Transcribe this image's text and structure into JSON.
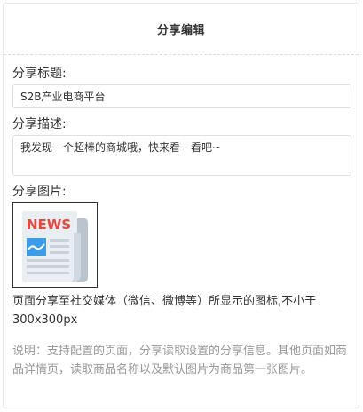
{
  "header": {
    "title": "分享编辑"
  },
  "form": {
    "title_label": "分享标题:",
    "title_value": "S2B产业电商平台",
    "desc_label": "分享描述:",
    "desc_value": "我发现一个超棒的商城哦，快来看一看吧~",
    "image_label": "分享图片:",
    "image": {
      "icon": "news-icon",
      "badge_text": "NEWS"
    },
    "image_hint": "页面分享至社交媒体（微信、微博等）所显示的图标,不小于300x300px",
    "note": "说明：支持配置的页面，分享读取设置的分享信息。其他页面如商品详情页，读取商品名称以及默认图片为商品第一张图片。"
  },
  "colors": {
    "border": "#dcdfe6",
    "note": "#999999",
    "news_red": "#e8473b",
    "news_blue": "#3d9be9"
  }
}
